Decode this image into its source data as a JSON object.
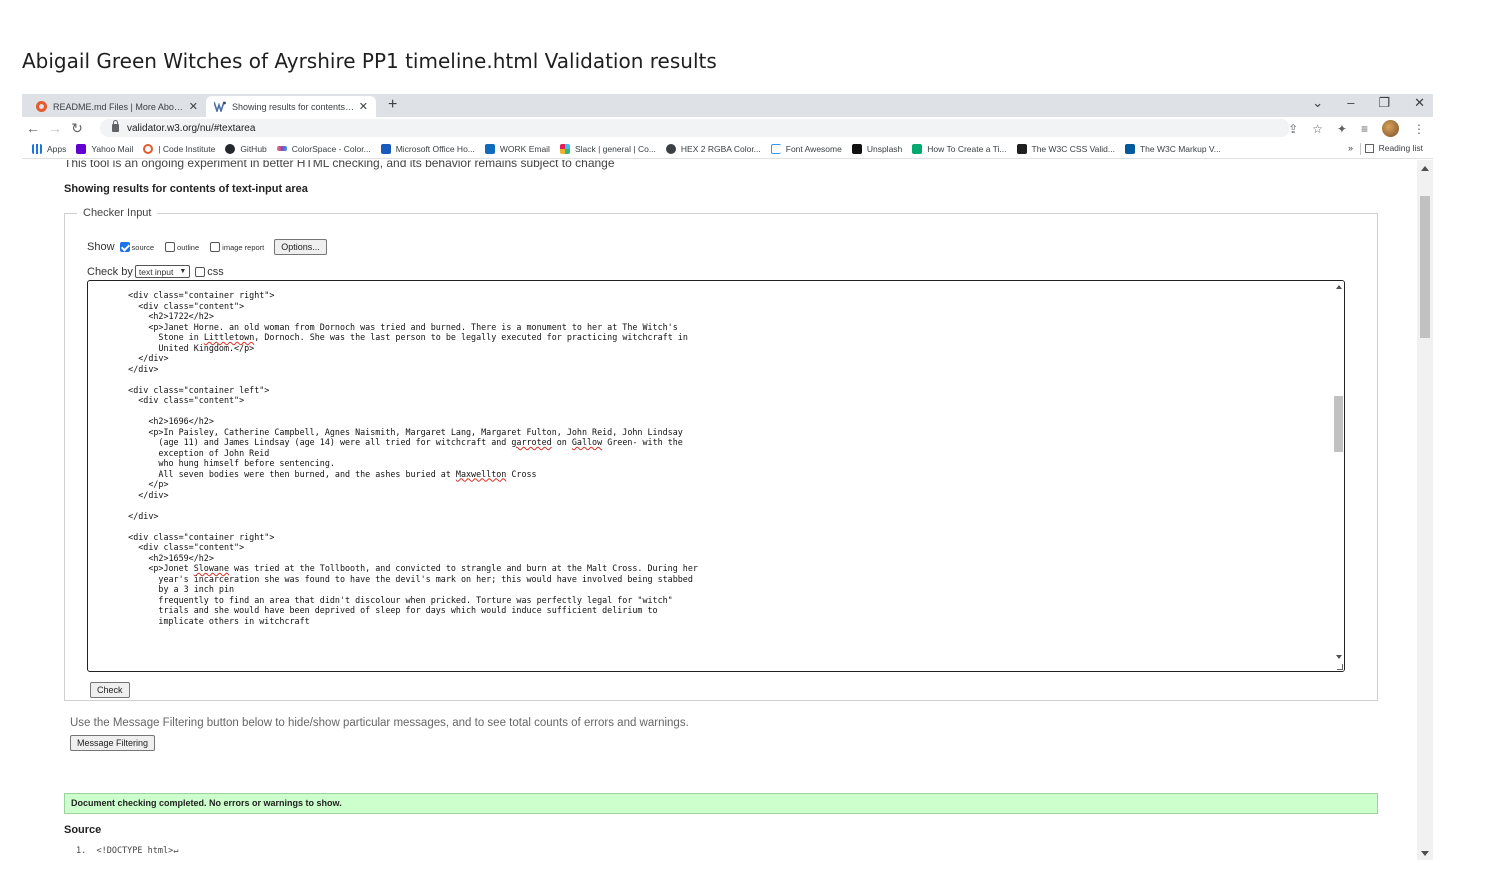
{
  "document_title": "Abigail Green Witches of Ayrshire PP1 timeline.html Validation results",
  "tabs": [
    {
      "label": "README.md Files | More About (",
      "active": false
    },
    {
      "label": "Showing results for contents of t",
      "active": true
    }
  ],
  "address_bar": {
    "url": "validator.w3.org/nu/#textarea"
  },
  "bookmarks": {
    "items": [
      {
        "label": "Apps",
        "icon": "apps-grid-icon",
        "color": "#1a73e8"
      },
      {
        "label": "Yahoo Mail",
        "icon": "yahoo-mail-icon",
        "color": "#6001d2"
      },
      {
        "label": "| Code Institute",
        "icon": "code-institute-icon",
        "color": "#e55b2d"
      },
      {
        "label": "GitHub",
        "icon": "github-icon",
        "color": "#24292f"
      },
      {
        "label": "ColorSpace - Color...",
        "icon": "colorspace-icon",
        "color": "#8a4baf"
      },
      {
        "label": "Microsoft Office Ho...",
        "icon": "microsoft-office-icon",
        "color": "#185abd"
      },
      {
        "label": "WORK Email",
        "icon": "outlook-icon",
        "color": "#0f6cbd"
      },
      {
        "label": "Slack | general | Co...",
        "icon": "slack-icon",
        "color": "#e01e5a"
      },
      {
        "label": "HEX 2 RGBA Color...",
        "icon": "hex2rgba-icon",
        "color": "#3c4043"
      },
      {
        "label": "Font Awesome",
        "icon": "font-awesome-flag-icon",
        "color": "#339af0"
      },
      {
        "label": "Unsplash",
        "icon": "unsplash-icon",
        "color": "#111111"
      },
      {
        "label": "How To Create a Ti...",
        "icon": "w3schools-icon",
        "color": "#04aa6d"
      },
      {
        "label": "The W3C CSS Valid...",
        "icon": "w3c-css-icon",
        "color": "#1f1f1f"
      },
      {
        "label": "The W3C Markup V...",
        "icon": "w3c-markup-icon",
        "color": "#005a9c"
      }
    ],
    "more": "»",
    "reading_list": "Reading list"
  },
  "page": {
    "cutoff_notice": "This tool is an ongoing experiment in better HTML checking, and its behavior remains subject to change",
    "results_heading": "Showing results for contents of text-input area",
    "fieldset_legend": "Checker Input",
    "show_label": "Show",
    "opt_source": "source",
    "opt_outline": "outline",
    "opt_image_report": "image report",
    "options_button": "Options...",
    "check_by_label": "Check by",
    "check_by_value": "text input",
    "css_label": "css",
    "check_button": "Check",
    "filter_hint": "Use the Message Filtering button below to hide/show particular messages, and to see total counts of errors and warnings.",
    "filter_button": "Message Filtering",
    "success_message": "Document checking completed. No errors or warnings to show.",
    "source_heading": "Source",
    "source_first_line": "1.  <!DOCTYPE html>↵"
  },
  "textarea_lines": [
    "    </div>",
    "",
    "    <div class=\"container right\">",
    "      <div class=\"content\">",
    "        <h2>1722</h2>",
    "        <p>Janet Horne. an old woman from Dornoch was tried and burned. There is a monument to her at The Witch's",
    "          Stone in Littletown, Dornoch. She was the last person to be legally executed for practicing witchcraft in",
    "          United Kingdom.</p>",
    "      </div>",
    "    </div>",
    "",
    "    <div class=\"container left\">",
    "      <div class=\"content\">",
    "",
    "        <h2>1696</h2>",
    "        <p>In Paisley, Catherine Campbell, Agnes Naismith, Margaret Lang, Margaret Fulton, John Reid, John Lindsay",
    "          (age 11) and James Lindsay (age 14) were all tried for witchcraft and garroted on Gallow Green- with the",
    "          exception of John Reid",
    "          who hung himself before sentencing.",
    "          All seven bodies were then burned, and the ashes buried at Maxwellton Cross",
    "        </p>",
    "      </div>",
    "",
    "    </div>",
    "",
    "    <div class=\"container right\">",
    "      <div class=\"content\">",
    "        <h2>1659</h2>",
    "        <p>Jonet Slowane was tried at the Tollbooth, and convicted to strangle and burn at the Malt Cross. During her",
    "          year's incarceration she was found to have the devil's mark on her; this would have involved being stabbed",
    "          by a 3 inch pin",
    "          frequently to find an area that didn't discolour when pricked. Torture was perfectly legal for \"witch\"",
    "          trials and she would have been deprived of sleep for days which would induce sufficient delirium to",
    "          implicate others in witchcraft"
  ],
  "spellcheck_words": [
    "Littletown",
    "garroted",
    "Gallow",
    "Maxwellton",
    "Slowane"
  ],
  "colors": {
    "success_bg": "#ccffcc",
    "tabstrip_bg": "#dee1e6",
    "checkbox_on": "#1a73e8"
  }
}
